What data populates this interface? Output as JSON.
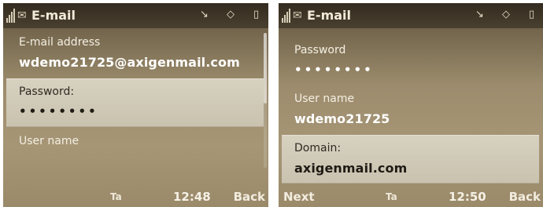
{
  "left_screen": {
    "status": {
      "title": "E-mail",
      "mail_glyph": "✉",
      "indicators": [
        "↘",
        "◇",
        "▯"
      ]
    },
    "items": [
      {
        "label": "E-mail address",
        "value": "wdemo21725@axigenmail.com"
      },
      {
        "label": "Password:",
        "value": "••••••••"
      },
      {
        "label": "User name",
        "value": ""
      }
    ],
    "softkeys": {
      "left": "",
      "input_mode": "Ta",
      "clock": "12:48",
      "right": "Back"
    }
  },
  "right_screen": {
    "status": {
      "title": "E-mail",
      "mail_glyph": "✉",
      "indicators": [
        "↘",
        "◇",
        "▯"
      ]
    },
    "items": [
      {
        "label": "Password",
        "value": "••••••••"
      },
      {
        "label": "User name",
        "value": "wdemo21725"
      },
      {
        "label": "Domain:",
        "value": "axigenmail.com"
      }
    ],
    "softkeys": {
      "left": "Next",
      "input_mode": "Ta",
      "clock": "12:50",
      "right": "Back"
    }
  }
}
